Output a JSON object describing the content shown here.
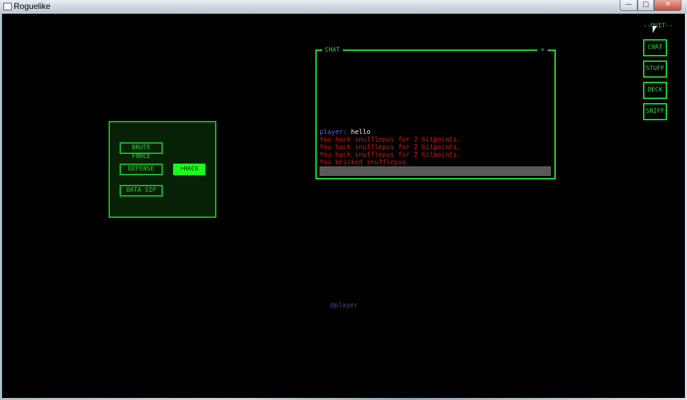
{
  "window": {
    "title": "Roguelike",
    "controls": {
      "minimize": "—",
      "maximize": "□",
      "close": "✕"
    }
  },
  "side_menu": {
    "quit_label": "--QUIT--",
    "buttons": [
      "CHAT",
      "STUFF",
      "DECK",
      "SNIFF"
    ]
  },
  "actions": {
    "brute_force": "BRUTE FORCE",
    "defense": "DEFENSE",
    "hack": ">HACK",
    "data_sip": "DATA SIP",
    "selected": "HACK"
  },
  "chat": {
    "title": "CHAT",
    "close": "×",
    "speaker": "player:",
    "message": " hello",
    "log": [
      "You hack snufflepus for 2 hitpoints.",
      "You hack snufflepus for 2 hitpoints.",
      "You hack snufflepus for 2 hitpoints.",
      "You bricked snufflepus."
    ],
    "input_value": ""
  },
  "map": {
    "player_label": "@player"
  },
  "colors": {
    "ui_green": "#1ee62b",
    "selected_green": "#1aff1a",
    "combat_red": "#d61818",
    "speaker_purple": "#6d5fc7",
    "background": "#000000"
  }
}
